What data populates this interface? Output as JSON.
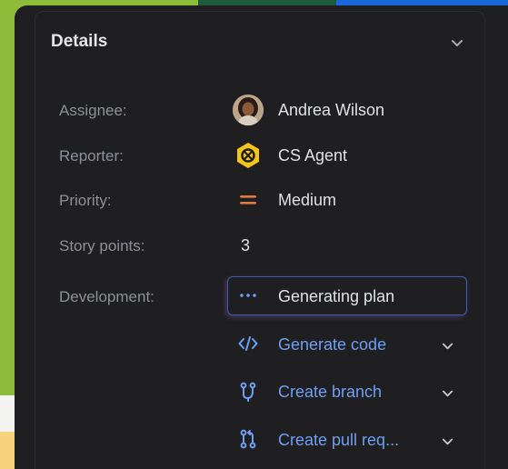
{
  "details": {
    "title": "Details",
    "fields": {
      "assignee": {
        "label": "Assignee:",
        "value": "Andrea Wilson"
      },
      "reporter": {
        "label": "Reporter:",
        "value": "CS Agent"
      },
      "priority": {
        "label": "Priority:",
        "value": "Medium"
      },
      "story_points": {
        "label": "Story points:",
        "value": "3"
      },
      "development": {
        "label": "Development:",
        "status": "Generating plan"
      }
    },
    "actions": [
      {
        "label": "Generate code",
        "icon": "code-icon"
      },
      {
        "label": "Create branch",
        "icon": "branch-icon"
      },
      {
        "label": "Create pull req...",
        "icon": "pull-request-icon"
      }
    ]
  },
  "colors": {
    "panel_bg": "#1f1f21",
    "label_text": "#8c8f96",
    "value_text": "#dfe1e5",
    "link": "#6d9ff2",
    "priority_medium": "#e07a3f",
    "reporter_hex": "#f5c518"
  }
}
